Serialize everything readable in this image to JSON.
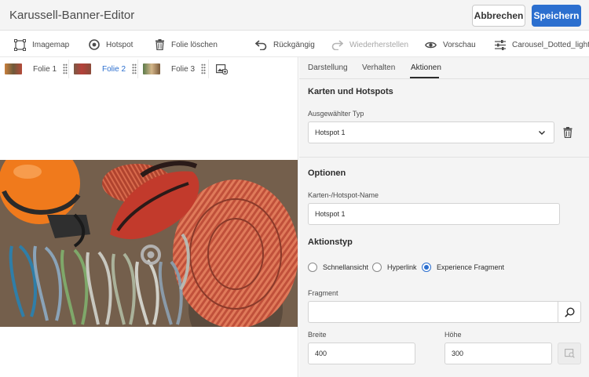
{
  "header": {
    "title": "Karussell-Banner-Editor",
    "cancel_label": "Abbrechen",
    "save_label": "Speichern"
  },
  "toolbar": {
    "imagemap": "Imagemap",
    "hotspot": "Hotspot",
    "delete_slide": "Folie löschen",
    "undo": "Rückgängig",
    "redo": "Wiederherstellen",
    "preview": "Vorschau",
    "preset": "Carousel_Dotted_light"
  },
  "slides": [
    {
      "label": "Folie 1"
    },
    {
      "label": "Folie 2"
    },
    {
      "label": "Folie 3"
    }
  ],
  "panel": {
    "tabs": [
      "Darstellung",
      "Verhalten",
      "Aktionen"
    ],
    "active_tab": "Aktionen",
    "cards_section": "Karten und Hotspots",
    "selected_type_label": "Ausgewählter Typ",
    "selected_type_value": "Hotspot 1",
    "options_section": "Optionen",
    "name_label": "Karten-/Hotspot-Name",
    "name_value": "Hotspot 1",
    "action_type_section": "Aktionstyp",
    "radios": [
      "Schnellansicht",
      "Hyperlink",
      "Experience Fragment"
    ],
    "selected_radio": "Experience Fragment",
    "fragment_label": "Fragment",
    "fragment_value": "",
    "width_label": "Breite",
    "width_value": "400",
    "height_label": "Höhe",
    "height_value": "300"
  },
  "colors": {
    "accent": "#2c6fcf",
    "panel_bg": "#f4f4f4"
  }
}
